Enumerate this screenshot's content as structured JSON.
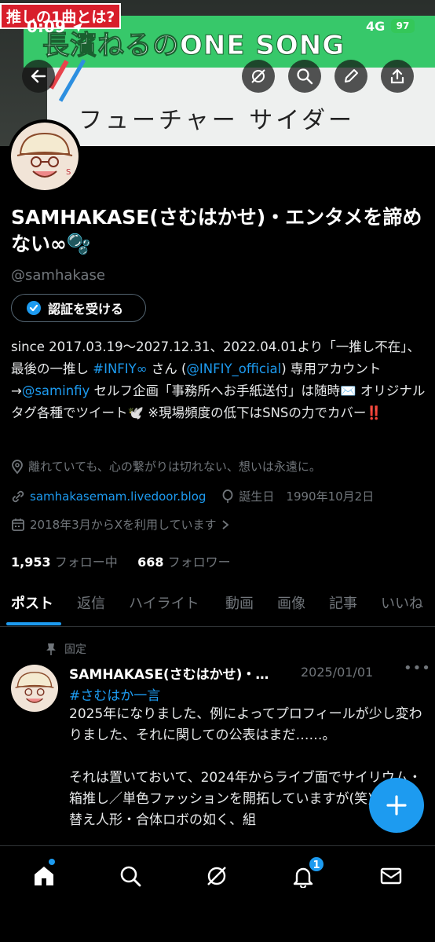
{
  "status_bar": {
    "time": "0:09",
    "network": "4G",
    "battery": "97"
  },
  "banner": {
    "tag": "推しの1曲とは?",
    "title": "長濱ねるのONE SONG",
    "handwriting": "フューチャー サイダー"
  },
  "profile": {
    "name": "SAMHAKASE(さむはかせ)・エンタメを諦めない∞🫧",
    "handle": "@samhakase",
    "verify_label": "認証を受ける",
    "bio": {
      "p1": "since 2017.03.19～2027.12.31、2022.04.01より「一推し不在」、最後の一推し ",
      "tag1": "#INFIY∞",
      "p2": " さん (",
      "mention1": "@INFIY_official",
      "p3": ") 専用アカウント →",
      "mention2": "@saminfiy",
      "p4": " セルフ企画「事務所へお手紙送付」は随時✉️ オリジナルタグ各種でツイート🕊️ ※現場頻度の低下はSNSの力でカバー‼️"
    },
    "location": "離れていても、心の繋がりは切れない、想いは永遠に。",
    "website": "samhakasemam.livedoor.blog",
    "birthday": "誕生日　1990年10月2日",
    "joined": "2018年3月からXを利用しています",
    "following_count": "1,953",
    "following_label": "フォロー中",
    "followers_count": "668",
    "followers_label": "フォロワー"
  },
  "tabs": [
    "ポスト",
    "返信",
    "ハイライト",
    "動画",
    "画像",
    "記事",
    "いいね"
  ],
  "post": {
    "pinned_label": "固定",
    "author": "SAMHAKASE(さむはかせ)・…",
    "date": "2025/01/01",
    "hashtag": "#さむはか一言",
    "body_line1": "2025年になりました、例によってプロフィールが少し変わりました、それに関しての公表はまだ……。",
    "body_line2": "それは置いておいて、2024年からライブ面でサイリウム・箱推し／単色ファッションを開拓していますが(笑)、着せ替え人形・合体ロボの如く、組"
  },
  "nav": {
    "icons": [
      "home-icon",
      "search-icon",
      "grok-icon",
      "notifications-icon",
      "messages-icon"
    ],
    "notification_badge": "1"
  },
  "colors": {
    "accent": "#1d9bf0",
    "background": "#000000",
    "muted": "#71767b"
  }
}
